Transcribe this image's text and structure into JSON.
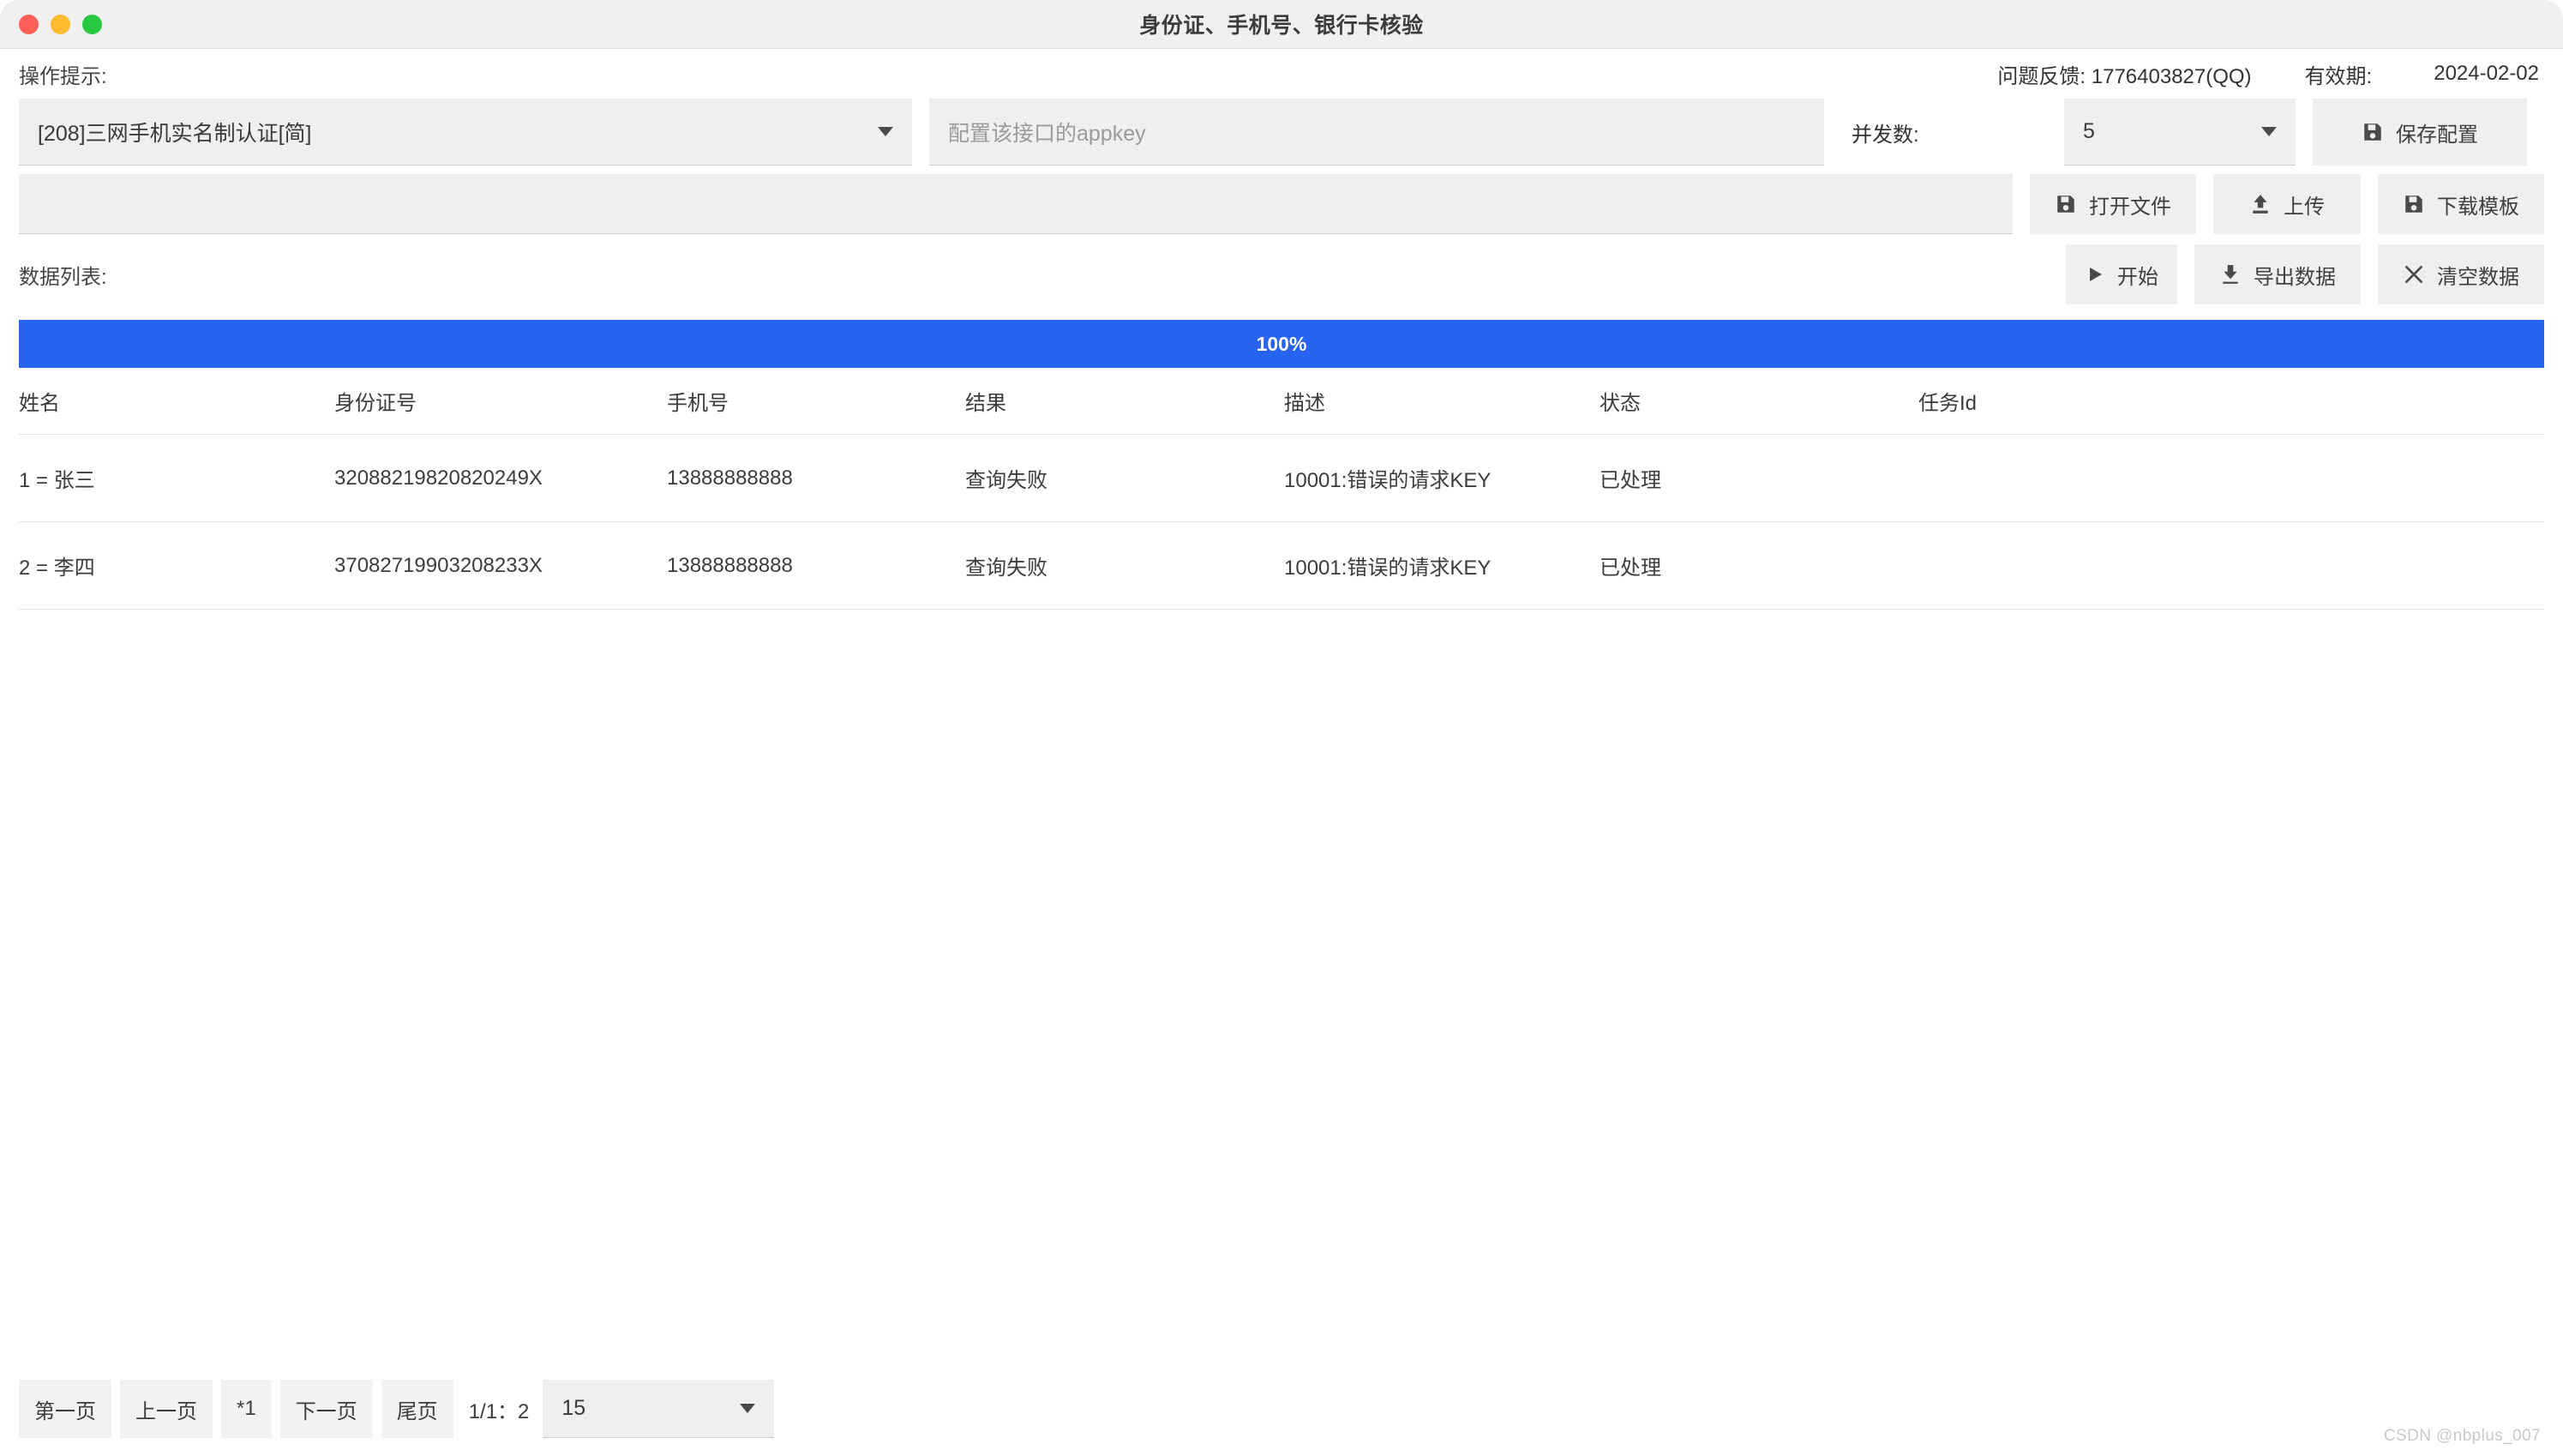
{
  "window": {
    "title": "身份证、手机号、银行卡核验",
    "traffic_lights": [
      {
        "name": "close",
        "color": "#ff5f57"
      },
      {
        "name": "minimize",
        "color": "#febc2e"
      },
      {
        "name": "zoom",
        "color": "#28c840"
      }
    ]
  },
  "header": {
    "hint_label": "操作提示:",
    "feedback": "问题反馈: 1776403827(QQ)",
    "expire_label": "有效期:",
    "expire_value": "2024-02-02"
  },
  "config_row": {
    "api_select_value": "[208]三网手机实名制认证[简]",
    "appkey_placeholder": "配置该接口的appkey",
    "appkey_value": "",
    "concurrency_label": "并发数:",
    "concurrency_value": "5",
    "save_config_label": "保存配置",
    "save_config_icon": "save-icon"
  },
  "file_row": {
    "filepath_value": "",
    "open_file_label": "打开文件",
    "open_file_icon": "save-icon",
    "upload_label": "上传",
    "upload_icon": "upload-icon",
    "download_template_label": "下载模板",
    "download_template_icon": "save-icon"
  },
  "actions_row": {
    "datalist_label": "数据列表:",
    "start_label": "开始",
    "start_icon": "play-icon",
    "export_label": "导出数据",
    "export_icon": "download-icon",
    "clear_label": "清空数据",
    "clear_icon": "close-x-icon"
  },
  "progress": {
    "percent": 100,
    "text": "100%",
    "fill_color": "#2563f0"
  },
  "table": {
    "columns": [
      "姓名",
      "身份证号",
      "手机号",
      "结果",
      "描述",
      "状态",
      "任务Id"
    ],
    "rows": [
      {
        "name": "1 = 张三",
        "id_number": "32088219820820249X",
        "phone": "13888888888",
        "result": "查询失败",
        "description": "10001:错误的请求KEY",
        "status": "已处理",
        "task_id": ""
      },
      {
        "name": "2 = 李四",
        "id_number": "37082719903208233X",
        "phone": "13888888888",
        "result": "查询失败",
        "description": "10001:错误的请求KEY",
        "status": "已处理",
        "task_id": ""
      }
    ]
  },
  "pagination": {
    "first_label": "第一页",
    "prev_label": "上一页",
    "current_label": "*1",
    "next_label": "下一页",
    "last_label": "尾页",
    "indicator": "1/1：2",
    "page_size_value": "15"
  },
  "watermark": "CSDN @nbplus_007"
}
